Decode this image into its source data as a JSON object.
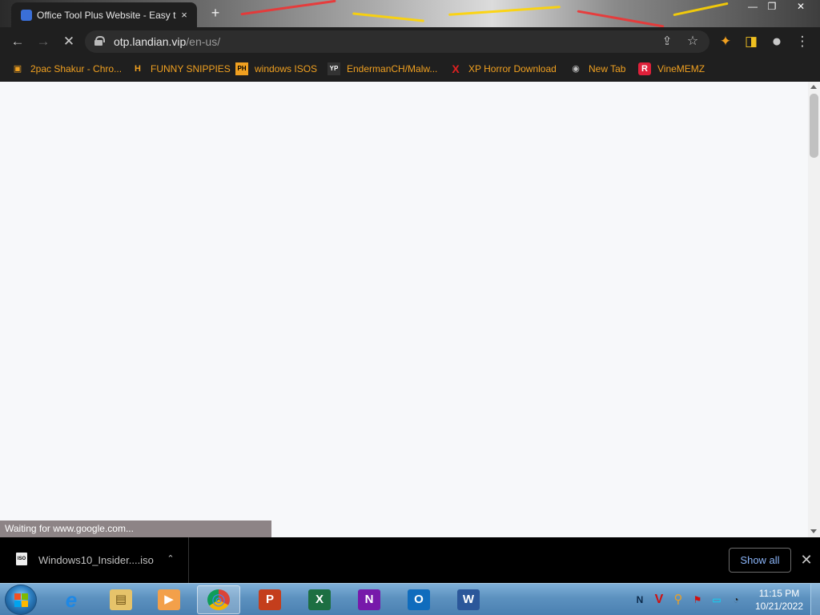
{
  "tab": {
    "title": "Office Tool Plus Website - Easy t",
    "close_symbol": "×"
  },
  "window_controls": {
    "minimize": "—",
    "restore": "❐",
    "close": "✕"
  },
  "toolbar": {
    "back": "←",
    "forward": "→",
    "reload": "✕",
    "url_host": "otp.landian.vip",
    "url_path": "/en-us/",
    "share": "⇪",
    "star": "☆",
    "extensions": "✦",
    "sidepanel": "◨",
    "profile": "●",
    "menu": "⋮"
  },
  "bookmarks": [
    {
      "label": "2pac Shakur - Chro...",
      "icon": "shopping-bag-icon",
      "glyph": "▣",
      "color": "#e8e8e8"
    },
    {
      "label": "FUNNY SNIPPIES",
      "icon": "h-icon",
      "glyph": "H",
      "color": "#ffffff"
    },
    {
      "label": "windows ISOS",
      "icon": "ph-icon",
      "glyph": "PH",
      "color": "#f0a020"
    },
    {
      "label": "EndermanCH/Malw...",
      "icon": "yp-icon",
      "glyph": "YP",
      "color": "#444444"
    },
    {
      "label": "XP Horror Download",
      "icon": "x-icon",
      "glyph": "X",
      "color": "#e02020"
    },
    {
      "label": "New Tab",
      "icon": "globe-icon",
      "glyph": "◉",
      "color": "#c0c0c0"
    },
    {
      "label": "VineMEMZ",
      "icon": "r-icon",
      "glyph": "R",
      "color": "#e0203a"
    }
  ],
  "status_text": "Waiting for www.google.com...",
  "download": {
    "file_name": "Windows10_Insider....iso",
    "file_icon_text": "ISO",
    "chevron": "⌃",
    "show_all": "Show all",
    "close": "✕"
  },
  "taskbar": {
    "apps": [
      {
        "name": "internet-explorer-icon",
        "glyph": "e",
        "color": "#1e88e5"
      },
      {
        "name": "file-explorer-icon",
        "glyph": "▤",
        "color": "#e6c36a"
      },
      {
        "name": "media-player-icon",
        "glyph": "▶",
        "color": "#e58a2a"
      },
      {
        "name": "chrome-icon",
        "glyph": "◎",
        "color": "#db4437"
      },
      {
        "name": "powerpoint-icon",
        "glyph": "P",
        "color": "#c43e1c"
      },
      {
        "name": "excel-icon",
        "glyph": "X",
        "color": "#1d6f42"
      },
      {
        "name": "onenote-icon",
        "glyph": "N",
        "color": "#7719aa"
      },
      {
        "name": "outlook-icon",
        "glyph": "O",
        "color": "#0f6cbd"
      },
      {
        "name": "word-icon",
        "glyph": "W",
        "color": "#2b579a"
      }
    ],
    "tray": [
      {
        "name": "language-icon",
        "glyph": "N"
      },
      {
        "name": "antivirus-icon",
        "glyph": "V"
      },
      {
        "name": "search-tray-icon",
        "glyph": "⚲"
      },
      {
        "name": "flag-icon",
        "glyph": "⚑"
      },
      {
        "name": "monitor-icon",
        "glyph": "▭"
      },
      {
        "name": "volume-icon",
        "glyph": "◔"
      }
    ],
    "time": "11:15 PM",
    "date": "10/21/2022"
  }
}
